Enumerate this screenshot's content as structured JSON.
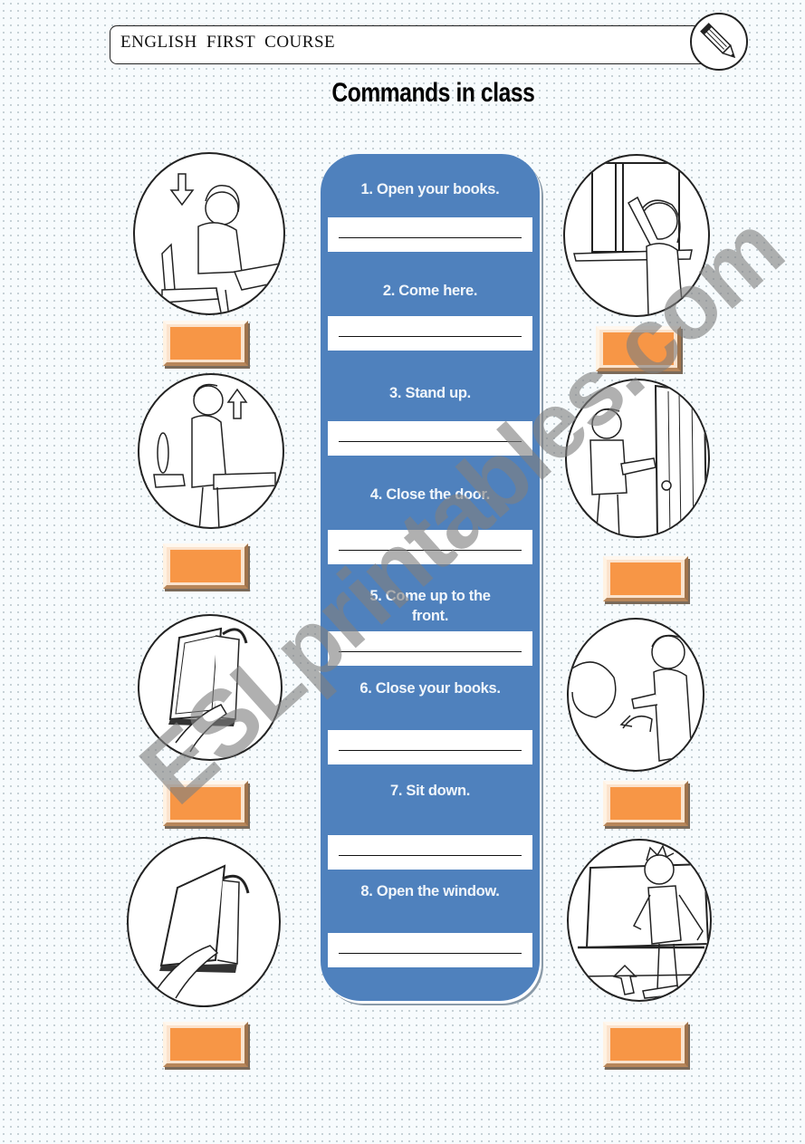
{
  "header": {
    "course_label": "ENGLISH  FIRST  COURSE",
    "icon": "pencil-icon"
  },
  "title": "Commands in class",
  "commands": [
    {
      "label": "1. Open your books.",
      "answer": ""
    },
    {
      "label": "2. Come here.",
      "answer": ""
    },
    {
      "label": "3. Stand up.",
      "answer": ""
    },
    {
      "label": "4. Close the door.",
      "answer": ""
    },
    {
      "label": "5. Come up to the front.",
      "answer": ""
    },
    {
      "label": "6. Close your books.",
      "answer": ""
    },
    {
      "label": "7. Sit down.",
      "answer": ""
    },
    {
      "label": "8. Open the window.",
      "answer": ""
    }
  ],
  "pictures": {
    "left": [
      {
        "depicts": "girl-sitting-down",
        "arrow": "down"
      },
      {
        "depicts": "girl-standing-up",
        "arrow": "up"
      },
      {
        "depicts": "closing-book",
        "arrow": "curved-right"
      },
      {
        "depicts": "opening-book",
        "arrow": "curved-left"
      }
    ],
    "right": [
      {
        "depicts": "girl-opening-window"
      },
      {
        "depicts": "boy-closing-door"
      },
      {
        "depicts": "teacher-calling-boy"
      },
      {
        "depicts": "boy-walking-to-board"
      }
    ]
  },
  "number_boxes": {
    "left": [
      "",
      "",
      "",
      ""
    ],
    "right": [
      "",
      "",
      "",
      ""
    ]
  },
  "colors": {
    "panel": "#4f81bd",
    "number_box": "#f79646"
  },
  "watermark": "ESLprintables.com"
}
